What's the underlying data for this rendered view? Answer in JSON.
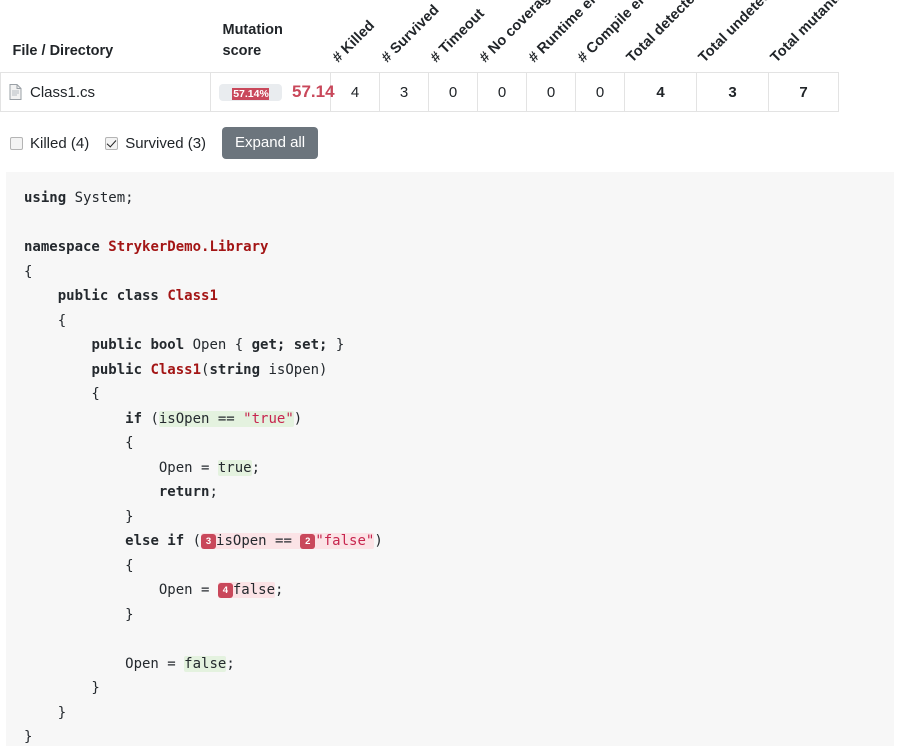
{
  "table": {
    "columns": [
      {
        "label": "File / Directory",
        "rotated": false,
        "kind": "file"
      },
      {
        "label": "Mutation\nscore",
        "rotated": false,
        "kind": "score"
      },
      {
        "label": "# Killed",
        "rotated": true,
        "kind": "num"
      },
      {
        "label": "# Survived",
        "rotated": true,
        "kind": "num"
      },
      {
        "label": "# Timeout",
        "rotated": true,
        "kind": "num"
      },
      {
        "label": "# No coverage",
        "rotated": true,
        "kind": "num"
      },
      {
        "label": "# Runtime errors",
        "rotated": true,
        "kind": "num"
      },
      {
        "label": "# Compile errors",
        "rotated": true,
        "kind": "num"
      },
      {
        "label": "Total detected",
        "rotated": true,
        "kind": "num-bold"
      },
      {
        "label": "Total undetected",
        "rotated": true,
        "kind": "num-bold"
      },
      {
        "label": "Total mutants",
        "rotated": true,
        "kind": "num-bold"
      }
    ],
    "rows": [
      {
        "file_icon": "file-icon",
        "file_name": "Class1.cs",
        "score_bar_label": "57.14%",
        "score_percent": 57.14,
        "score_value": "57.14",
        "cells": [
          "4",
          "3",
          "0",
          "0",
          "0",
          "0",
          "4",
          "3",
          "7"
        ]
      }
    ]
  },
  "filters": {
    "killed": {
      "label": "Killed (4)",
      "checked": false
    },
    "survived": {
      "label": "Survived (3)",
      "checked": true
    },
    "expand_all_label": "Expand all"
  },
  "colors": {
    "score_red": "#c9485b",
    "killed_highlight": "#e4f2df",
    "survived_highlight": "#fbe3e6",
    "button_gray": "#6c757d",
    "code_background": "#f7f7f7"
  },
  "code": {
    "language": "csharp",
    "lines": [
      "using System;",
      "",
      "namespace StrykerDemo.Library",
      "{",
      "    public class Class1",
      "    {",
      "        public bool Open { get; set; }",
      "        public Class1(string isOpen)",
      "        {",
      "            if (isOpen == \"true\")",
      "            {",
      "                Open = true;",
      "                return;",
      "            }",
      "            else if (isOpen == \"false\")",
      "            {",
      "                Open = false;",
      "            }",
      "",
      "            Open = false;",
      "        }",
      "    }",
      "}"
    ],
    "mutants": [
      {
        "id": "3",
        "status": "Survived",
        "line": 15,
        "text": "isOpen == "
      },
      {
        "id": "2",
        "status": "Survived",
        "line": 15,
        "text": "\"false\""
      },
      {
        "id": "4",
        "status": "Survived",
        "line": 17,
        "text": "false"
      }
    ]
  }
}
